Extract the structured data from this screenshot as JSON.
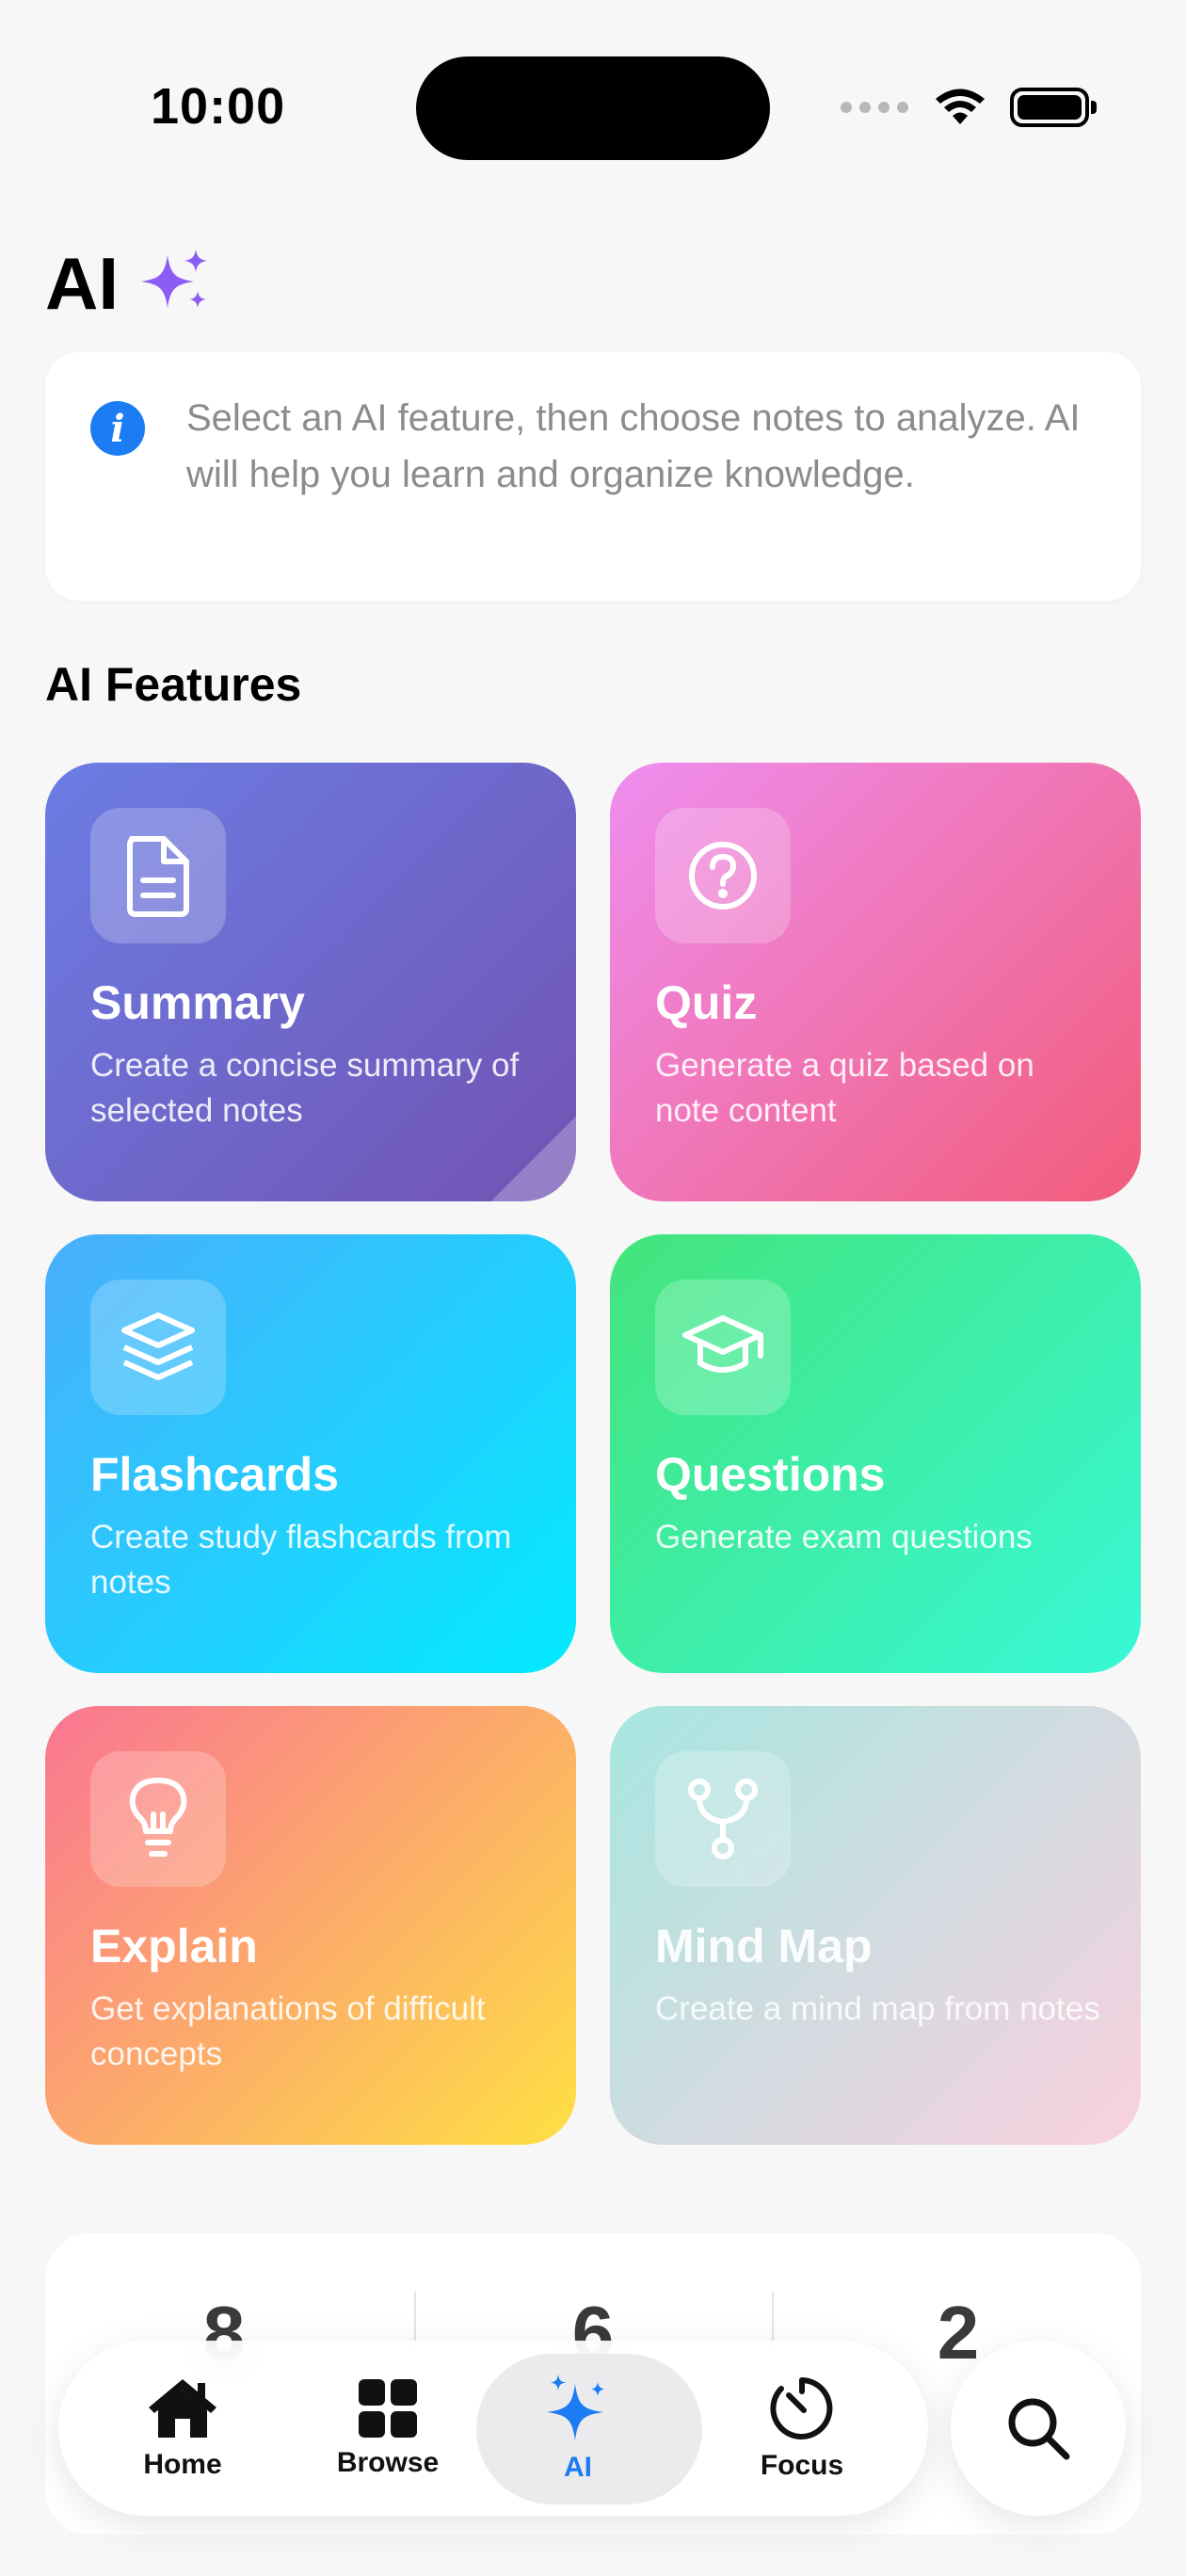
{
  "status_bar": {
    "time": "10:00"
  },
  "header": {
    "title": "AI"
  },
  "info": {
    "text": "Select an AI feature, then choose notes to analyze. AI will help you learn and organize knowledge."
  },
  "features": {
    "section_title": "AI Features",
    "items": [
      {
        "title": "Summary",
        "desc": "Create a concise summary of selected notes",
        "icon": "document-icon"
      },
      {
        "title": "Quiz",
        "desc": "Generate a quiz based on note content",
        "icon": "question-circle-icon"
      },
      {
        "title": "Flashcards",
        "desc": "Create study flashcards from notes",
        "icon": "layers-icon"
      },
      {
        "title": "Questions",
        "desc": "Generate exam questions",
        "icon": "graduation-cap-icon"
      },
      {
        "title": "Explain",
        "desc": "Get explanations of difficult concepts",
        "icon": "lightbulb-icon"
      },
      {
        "title": "Mind Map",
        "desc": "Create a mind map from notes",
        "icon": "branch-icon"
      }
    ]
  },
  "stats": [
    {
      "value": "8",
      "label": ""
    },
    {
      "value": "6",
      "label": ""
    },
    {
      "value": "2",
      "label": ""
    }
  ],
  "tabbar": {
    "tabs": [
      {
        "label": "Home",
        "icon": "house-icon"
      },
      {
        "label": "Browse",
        "icon": "grid-icon"
      },
      {
        "label": "AI",
        "icon": "sparkles-icon",
        "active": true
      },
      {
        "label": "Focus",
        "icon": "timer-icon"
      }
    ],
    "search_icon": "search-icon"
  },
  "colors": {
    "accent": "#1b7cf3",
    "sparkle": "#8b5cf6"
  }
}
